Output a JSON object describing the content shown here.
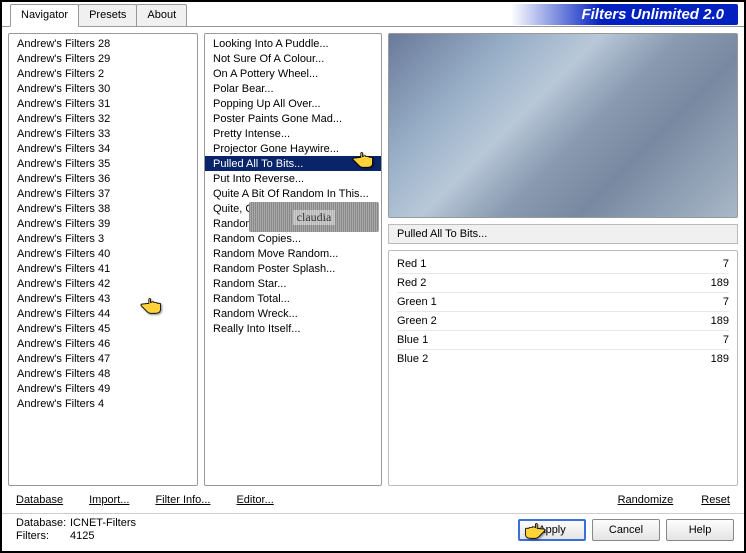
{
  "title": "Filters Unlimited 2.0",
  "tabs": [
    {
      "label": "Navigator",
      "active": true
    },
    {
      "label": "Presets",
      "active": false
    },
    {
      "label": "About",
      "active": false
    }
  ],
  "categories": [
    "Andrew's Filters 28",
    "Andrew's Filters 29",
    "Andrew's Filters 2",
    "Andrew's Filters 30",
    "Andrew's Filters 31",
    "Andrew's Filters 32",
    "Andrew's Filters 33",
    "Andrew's Filters 34",
    "Andrew's Filters 35",
    "Andrew's Filters 36",
    "Andrew's Filters 37",
    "Andrew's Filters 38",
    "Andrew's Filters 39",
    "Andrew's Filters 3",
    "Andrew's Filters 40",
    "Andrew's Filters 41",
    "Andrew's Filters 42",
    "Andrew's Filters 43",
    "Andrew's Filters 44",
    "Andrew's Filters 45",
    "Andrew's Filters 46",
    "Andrew's Filters 47",
    "Andrew's Filters 48",
    "Andrew's Filters 49",
    "Andrew's Filters 4"
  ],
  "selected_category_index": 14,
  "filters": [
    "Looking Into A Puddle...",
    "Not Sure Of A Colour...",
    "On A Pottery Wheel...",
    "Polar Bear...",
    "Popping Up All Over...",
    "Poster Paints Gone Mad...",
    "Pretty Intense...",
    "Projector Gone Haywire...",
    "Pulled All To Bits...",
    "Put Into Reverse...",
    "Quite A Bit Of Random In This...",
    "Quite, Quite Frightening...",
    "Random Colour In Your Hair...",
    "Random Copies...",
    "Random Move Random...",
    "Random Poster Splash...",
    "Random Star...",
    "Random Total...",
    "Random Wreck...",
    "Really Into Itself..."
  ],
  "selected_filter_index": 8,
  "current_filter_label": "Pulled All To Bits...",
  "watermark": "claudia",
  "params": [
    {
      "name": "Red 1",
      "value": 7
    },
    {
      "name": "Red 2",
      "value": 189
    },
    {
      "name": "Green 1",
      "value": 7
    },
    {
      "name": "Green 2",
      "value": 189
    },
    {
      "name": "Blue 1",
      "value": 7
    },
    {
      "name": "Blue 2",
      "value": 189
    }
  ],
  "bottom_links": {
    "database": "Database",
    "import": "Import...",
    "filter_info": "Filter Info...",
    "editor": "Editor...",
    "randomize": "Randomize",
    "reset": "Reset"
  },
  "status": {
    "database_label": "Database:",
    "database_value": "ICNET-Filters",
    "filters_label": "Filters:",
    "filters_value": "4125"
  },
  "buttons": {
    "apply": "Apply",
    "cancel": "Cancel",
    "help": "Help"
  }
}
